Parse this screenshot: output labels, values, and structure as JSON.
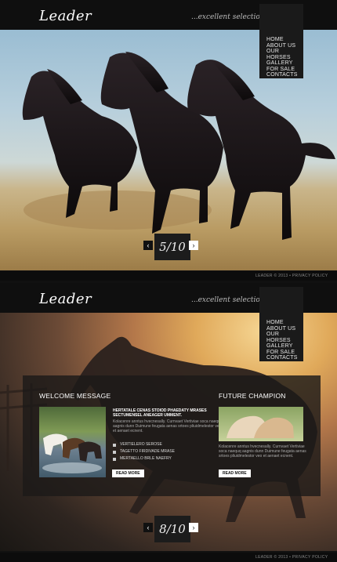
{
  "site": {
    "logo": "Leader",
    "tagline": "...excellent selection"
  },
  "nav": [
    "HOME",
    "ABOUT US",
    "OUR HORSES",
    "GALLERY",
    "FOR SALE",
    "CONTACTS"
  ],
  "slides": [
    {
      "pager": "5/10",
      "prev": "‹",
      "next": "›"
    },
    {
      "pager": "8/10",
      "prev": "‹",
      "next": "›"
    }
  ],
  "footer": "LEADER © 2013 • PRIVACY POLICY",
  "welcome": {
    "title": "WELCOME MESSAGE",
    "subhead": "HERTATALE CENAS STOIOD PHAEDATY MRASES SECTUMENSEL ANEAGER UMMENT.",
    "body": "Kolacenre anntus hvecnesally. Curnvaet Vertiviae soca naequq aagnis dunn Duimune feugata aenas srtoes pliuidmelestor veo et aenaet ecnent.",
    "links": [
      "VERTIELERO SEROSE",
      "TAGETTO FIRDIVADE MRASE",
      "MERTAELLO BRLE NAEFRY"
    ],
    "button": "READ MORE"
  },
  "champion": {
    "title": "FUTURE CHAMPION",
    "body": "Kolacenre anntus hvecnesally. Curnvaet Vertiviae soca naequq aagnis dunn Duimune feugata aenas srtoes pliuidmelestor veo et aenaet ecnent.",
    "button": "READ MORE"
  },
  "colors": {
    "bar": "#0f0f0f",
    "panel": "#1c1a18",
    "text": "#ffffff"
  },
  "icons": [
    "chevron-left-icon",
    "chevron-right-icon",
    "bullet-icon"
  ]
}
